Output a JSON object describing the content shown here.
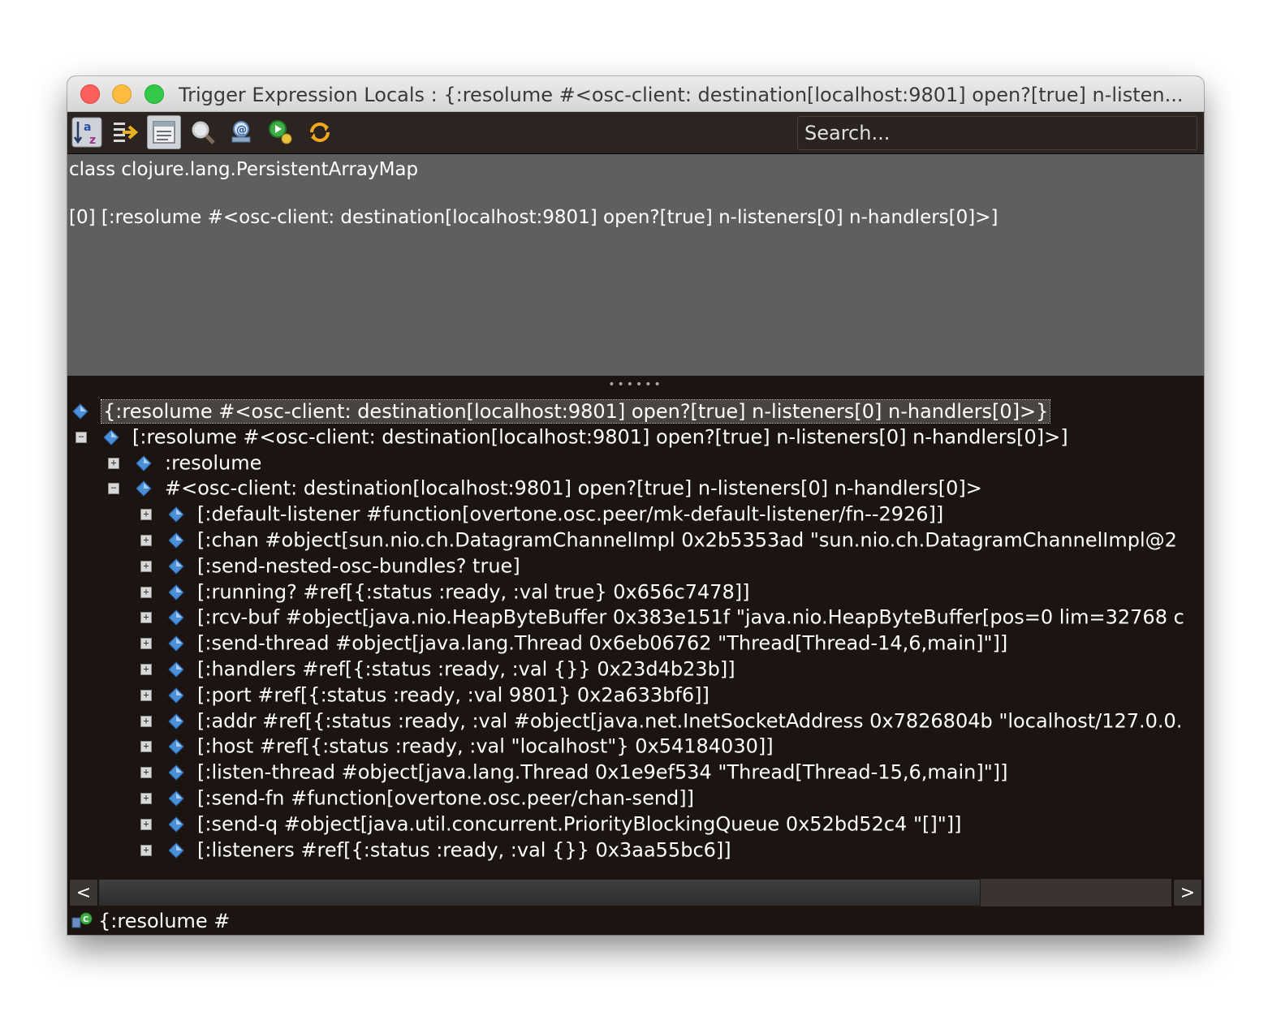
{
  "window": {
    "title": "Trigger Expression Locals : {:resolume #<osc-client: destination[localhost:9801] open?[true] n-listen..."
  },
  "toolbar": {
    "buttons": [
      {
        "name": "sort-alphabetically-icon",
        "pressed": false
      },
      {
        "name": "show-inherited-icon",
        "pressed": false
      },
      {
        "name": "show-details-icon",
        "pressed": true
      },
      {
        "name": "inspect-icon",
        "pressed": false
      },
      {
        "name": "watch-expression-icon",
        "pressed": false
      },
      {
        "name": "evaluate-icon",
        "pressed": false
      },
      {
        "name": "refresh-icon",
        "pressed": false
      }
    ],
    "search_placeholder": "Search..."
  },
  "info": {
    "class_line": "class clojure.lang.PersistentArrayMap",
    "entry_line": "[0] [:resolume #<osc-client: destination[localhost:9801] open?[true] n-listeners[0] n-handlers[0]>]"
  },
  "tree": {
    "rows": [
      {
        "text": "{:resolume #<osc-client: destination[localhost:9801] open?[true] n-listeners[0] n-handlers[0]>}",
        "level": 0,
        "expander": "none",
        "selected": true
      },
      {
        "text": "[:resolume #<osc-client: destination[localhost:9801] open?[true] n-listeners[0] n-handlers[0]>]",
        "level": 1,
        "expander": "minus",
        "selected": false
      },
      {
        "text": ":resolume",
        "level": 2,
        "expander": "plus",
        "selected": false
      },
      {
        "text": "#<osc-client: destination[localhost:9801] open?[true] n-listeners[0] n-handlers[0]>",
        "level": 2,
        "expander": "minus",
        "selected": false
      },
      {
        "text": "[:default-listener #function[overtone.osc.peer/mk-default-listener/fn--2926]]",
        "level": 3,
        "expander": "plus",
        "selected": false
      },
      {
        "text": "[:chan #object[sun.nio.ch.DatagramChannelImpl 0x2b5353ad \"sun.nio.ch.DatagramChannelImpl@2",
        "level": 3,
        "expander": "plus",
        "selected": false
      },
      {
        "text": "[:send-nested-osc-bundles? true]",
        "level": 3,
        "expander": "plus",
        "selected": false
      },
      {
        "text": "[:running? #ref[{:status :ready, :val true} 0x656c7478]]",
        "level": 3,
        "expander": "plus",
        "selected": false
      },
      {
        "text": "[:rcv-buf #object[java.nio.HeapByteBuffer 0x383e151f \"java.nio.HeapByteBuffer[pos=0 lim=32768 c",
        "level": 3,
        "expander": "plus",
        "selected": false
      },
      {
        "text": "[:send-thread #object[java.lang.Thread 0x6eb06762 \"Thread[Thread-14,6,main]\"]]",
        "level": 3,
        "expander": "plus",
        "selected": false
      },
      {
        "text": "[:handlers #ref[{:status :ready, :val {}} 0x23d4b23b]]",
        "level": 3,
        "expander": "plus",
        "selected": false
      },
      {
        "text": "[:port #ref[{:status :ready, :val 9801} 0x2a633bf6]]",
        "level": 3,
        "expander": "plus",
        "selected": false
      },
      {
        "text": "[:addr #ref[{:status :ready, :val #object[java.net.InetSocketAddress 0x7826804b \"localhost/127.0.0.",
        "level": 3,
        "expander": "plus",
        "selected": false
      },
      {
        "text": "[:host #ref[{:status :ready, :val \"localhost\"} 0x54184030]]",
        "level": 3,
        "expander": "plus",
        "selected": false
      },
      {
        "text": "[:listen-thread #object[java.lang.Thread 0x1e9ef534 \"Thread[Thread-15,6,main]\"]]",
        "level": 3,
        "expander": "plus",
        "selected": false
      },
      {
        "text": "[:send-fn #function[overtone.osc.peer/chan-send]]",
        "level": 3,
        "expander": "plus",
        "selected": false
      },
      {
        "text": "[:send-q #object[java.util.concurrent.PriorityBlockingQueue 0x52bd52c4 \"[]\"]]",
        "level": 3,
        "expander": "plus",
        "selected": false
      },
      {
        "text": "[:listeners #ref[{:status :ready, :val {}} 0x3aa55bc6]]",
        "level": 3,
        "expander": "plus",
        "selected": false
      }
    ]
  },
  "scrollbar": {
    "left_arrow": "<",
    "right_arrow": ">",
    "scroll_position": 0.0,
    "visible_fraction": 0.82
  },
  "statusbar": {
    "text": "{:resolume #",
    "icon": "class-icon"
  },
  "colors": {
    "accent_gem": "#4a90d9",
    "background": "#1b1411",
    "info_panel": "#5f5f5f"
  }
}
